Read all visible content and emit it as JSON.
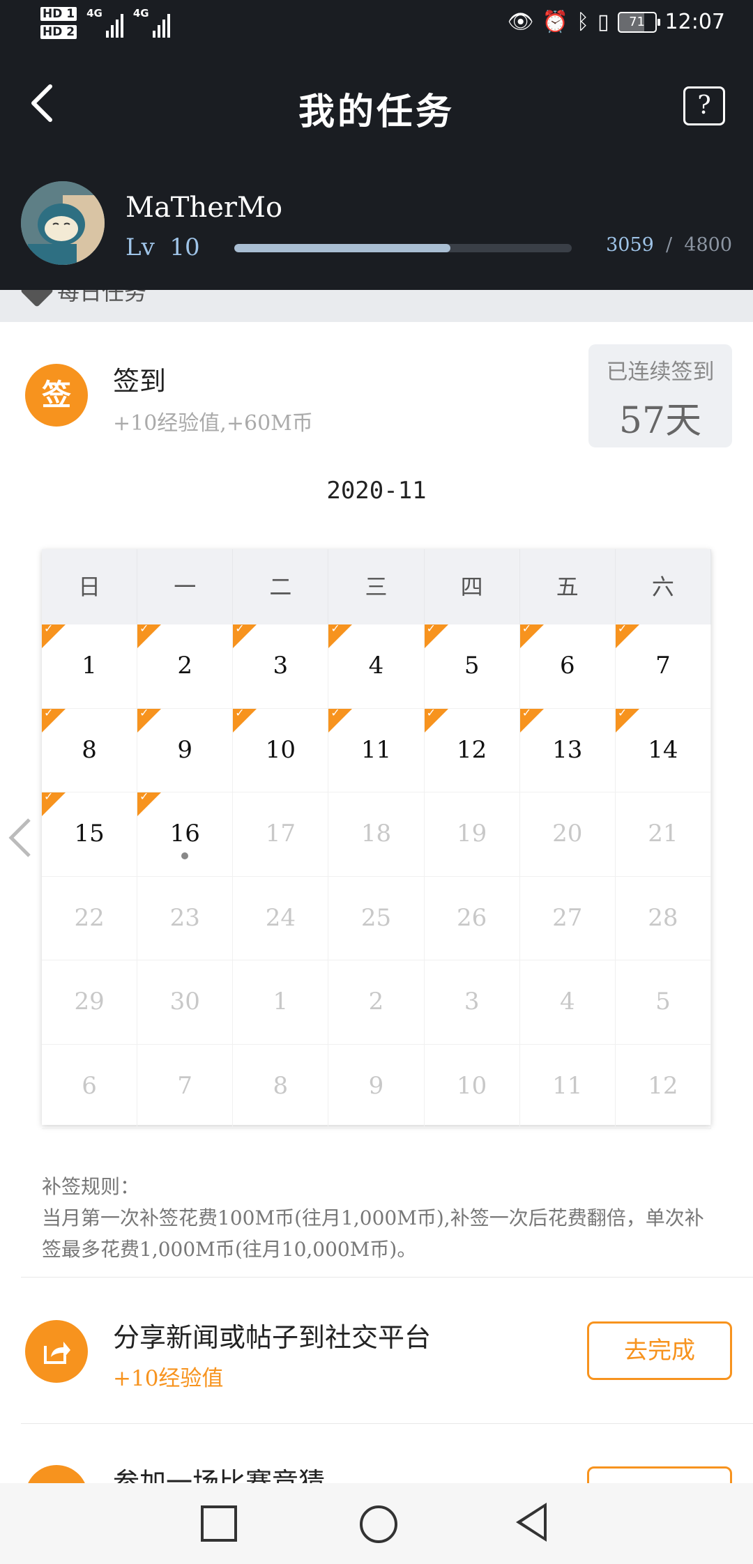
{
  "status_bar": {
    "sim1": "HD 1",
    "sim2": "HD 2",
    "network1": "4G",
    "network2": "4G",
    "battery": "71",
    "time": "12:07"
  },
  "header": {
    "title": "我的任务",
    "help_label": "?",
    "back_label": "<"
  },
  "user": {
    "name": "MaTherMo",
    "level_label": "Lv",
    "level": "10",
    "exp_current": "3059",
    "exp_separator": "/",
    "exp_total": "4800",
    "exp_progress": 0.64
  },
  "section": {
    "label": "每日任务"
  },
  "checkin": {
    "icon_text": "签",
    "title": "签到",
    "reward": "+10经验值,+60M币",
    "streak_label": "已连续签到",
    "streak_value": "57天"
  },
  "calendar": {
    "month": "2020-11",
    "weekdays": [
      "日",
      "一",
      "二",
      "三",
      "四",
      "五",
      "六"
    ],
    "days": [
      {
        "d": "1",
        "cur": true,
        "signed": true
      },
      {
        "d": "2",
        "cur": true,
        "signed": true
      },
      {
        "d": "3",
        "cur": true,
        "signed": true
      },
      {
        "d": "4",
        "cur": true,
        "signed": true
      },
      {
        "d": "5",
        "cur": true,
        "signed": true
      },
      {
        "d": "6",
        "cur": true,
        "signed": true
      },
      {
        "d": "7",
        "cur": true,
        "signed": true
      },
      {
        "d": "8",
        "cur": true,
        "signed": true
      },
      {
        "d": "9",
        "cur": true,
        "signed": true
      },
      {
        "d": "10",
        "cur": true,
        "signed": true
      },
      {
        "d": "11",
        "cur": true,
        "signed": true
      },
      {
        "d": "12",
        "cur": true,
        "signed": true
      },
      {
        "d": "13",
        "cur": true,
        "signed": true
      },
      {
        "d": "14",
        "cur": true,
        "signed": true
      },
      {
        "d": "15",
        "cur": true,
        "signed": true
      },
      {
        "d": "16",
        "cur": true,
        "signed": true,
        "today": true
      },
      {
        "d": "17",
        "cur": false
      },
      {
        "d": "18",
        "cur": false
      },
      {
        "d": "19",
        "cur": false
      },
      {
        "d": "20",
        "cur": false
      },
      {
        "d": "21",
        "cur": false
      },
      {
        "d": "22",
        "cur": false
      },
      {
        "d": "23",
        "cur": false
      },
      {
        "d": "24",
        "cur": false
      },
      {
        "d": "25",
        "cur": false
      },
      {
        "d": "26",
        "cur": false
      },
      {
        "d": "27",
        "cur": false
      },
      {
        "d": "28",
        "cur": false
      },
      {
        "d": "29",
        "cur": false
      },
      {
        "d": "30",
        "cur": false
      },
      {
        "d": "1",
        "cur": false
      },
      {
        "d": "2",
        "cur": false
      },
      {
        "d": "3",
        "cur": false
      },
      {
        "d": "4",
        "cur": false
      },
      {
        "d": "5",
        "cur": false
      },
      {
        "d": "6",
        "cur": false
      },
      {
        "d": "7",
        "cur": false
      },
      {
        "d": "8",
        "cur": false
      },
      {
        "d": "9",
        "cur": false
      },
      {
        "d": "10",
        "cur": false
      },
      {
        "d": "11",
        "cur": false
      },
      {
        "d": "12",
        "cur": false
      }
    ]
  },
  "rules": {
    "title": "补签规则：",
    "text": "当月第一次补签花费100M币(往月1,000M币),补签一次后花费翻倍，单次补签最多花费1,000M币(往月10,000M币)。"
  },
  "tasks": [
    {
      "title": "分享新闻或帖子到社交平台",
      "reward": "+10经验值",
      "button": "去完成",
      "icon": "share-icon"
    },
    {
      "title": "参加一场比赛竞猜",
      "reward": "",
      "button": "",
      "icon": "guess-icon"
    }
  ],
  "colors": {
    "accent": "#f7931e",
    "header_bg": "#1a1d22",
    "level_blue": "#9fc4e8"
  }
}
